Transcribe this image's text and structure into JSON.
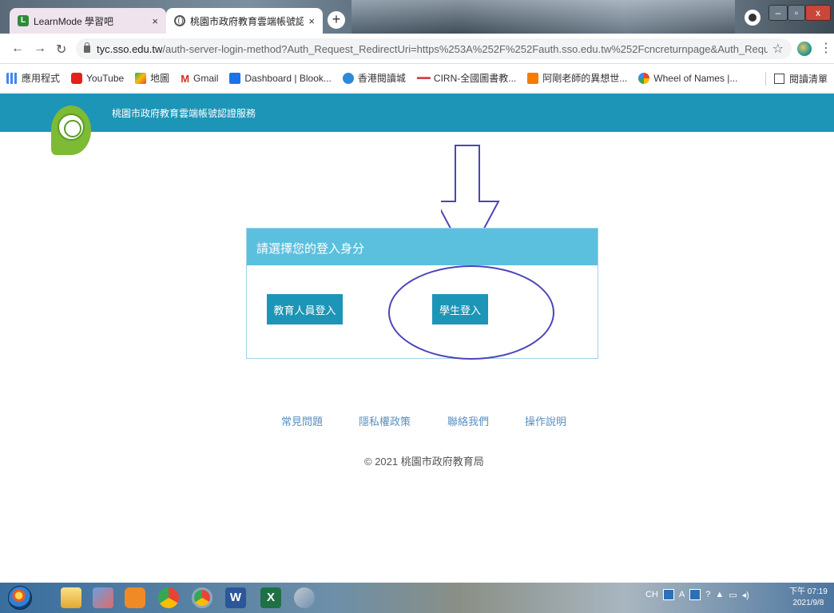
{
  "browser": {
    "tabs": [
      {
        "title": "LearnMode 學習吧",
        "icon": "learnmode-icon",
        "active": false
      },
      {
        "title": "桃園市政府教育雲端帳號認證服",
        "icon": "globe-icon",
        "active": true
      }
    ],
    "new_tab_label": "+",
    "close_label": "×",
    "window_controls": {
      "min": "–",
      "max": "▫",
      "close": "x"
    },
    "url_domain": "tyc.sso.edu.tw",
    "url_rest": "/auth-server-login-method?Auth_Request_RedirectUri=https%253A%252F%252Fauth.sso.edu.tw%252Fcncreturnpage&Auth_Request_Stat...",
    "bookmarks": [
      {
        "label": "應用程式",
        "icon": "apps-icon"
      },
      {
        "label": "YouTube",
        "icon": "youtube-icon"
      },
      {
        "label": "地圖",
        "icon": "maps-icon"
      },
      {
        "label": "Gmail",
        "icon": "gmail-icon"
      },
      {
        "label": "Dashboard | Blook...",
        "icon": "dashboard-icon"
      },
      {
        "label": "香港閱讀城",
        "icon": "hk-reading-icon"
      },
      {
        "label": "CIRN-全國圖書教...",
        "icon": "cirn-icon"
      },
      {
        "label": "阿剛老師的異想世...",
        "icon": "blogger-icon"
      },
      {
        "label": "Wheel of Names |...",
        "icon": "wheel-icon"
      }
    ],
    "reading_list": "閱讀清單"
  },
  "site": {
    "title": "桃園市政府教育雲端帳號認證服務",
    "panel_heading": "請選擇您的登入身分",
    "buttons": {
      "teacher": "教育人員登入",
      "student": "學生登入"
    },
    "footer_links": [
      "常見問題",
      "隱私權政策",
      "聯絡我們",
      "操作說明"
    ],
    "copyright": "© 2021 桃園市政府教育局"
  },
  "taskbar": {
    "tray_lang": "CH",
    "tray_a": "A",
    "time": "下午 07:19",
    "date": "2021/9/8"
  },
  "colors": {
    "brand_blue": "#1c95b7",
    "panel_head": "#5bc0de",
    "annotation": "#4b45b8"
  }
}
